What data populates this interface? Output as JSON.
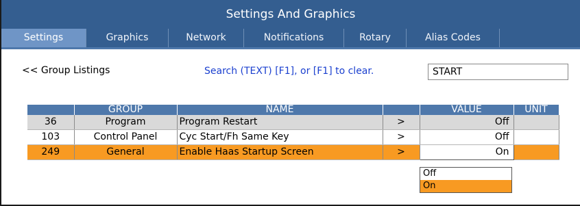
{
  "window": {
    "title": "Settings And Graphics"
  },
  "tabs": [
    {
      "label": "Settings"
    },
    {
      "label": "Graphics"
    },
    {
      "label": "Network"
    },
    {
      "label": "Notifications"
    },
    {
      "label": "Rotary"
    },
    {
      "label": "Alias Codes"
    }
  ],
  "active_tab": "Settings",
  "group_listings_link": "<< Group Listings",
  "search": {
    "hint": "Search (TEXT) [F1], or [F1] to clear.",
    "value": "START"
  },
  "table": {
    "headers": {
      "num": "",
      "group": "GROUP",
      "name": "NAME",
      "arrow": "",
      "value": "VALUE",
      "unit": "UNIT"
    },
    "rows": [
      {
        "num": "36",
        "group": "Program",
        "name": "Program Restart",
        "arrow": ">",
        "value": "Off",
        "unit": ""
      },
      {
        "num": "103",
        "group": "Control Panel",
        "name": "Cyc Start/Fh Same Key",
        "arrow": ">",
        "value": "Off",
        "unit": ""
      },
      {
        "num": "249",
        "group": "General",
        "name": "Enable Haas Startup Screen",
        "arrow": ">",
        "value": "On",
        "unit": ""
      }
    ],
    "selected_row": 2
  },
  "dropdown": {
    "options": [
      {
        "label": "Off"
      },
      {
        "label": "On"
      }
    ],
    "highlighted": "On"
  },
  "colors": {
    "header_blue": "#345e90",
    "active_tab": "#6f95c6",
    "selection_orange": "#f89a22",
    "hint_text": "#1a3fcf"
  }
}
